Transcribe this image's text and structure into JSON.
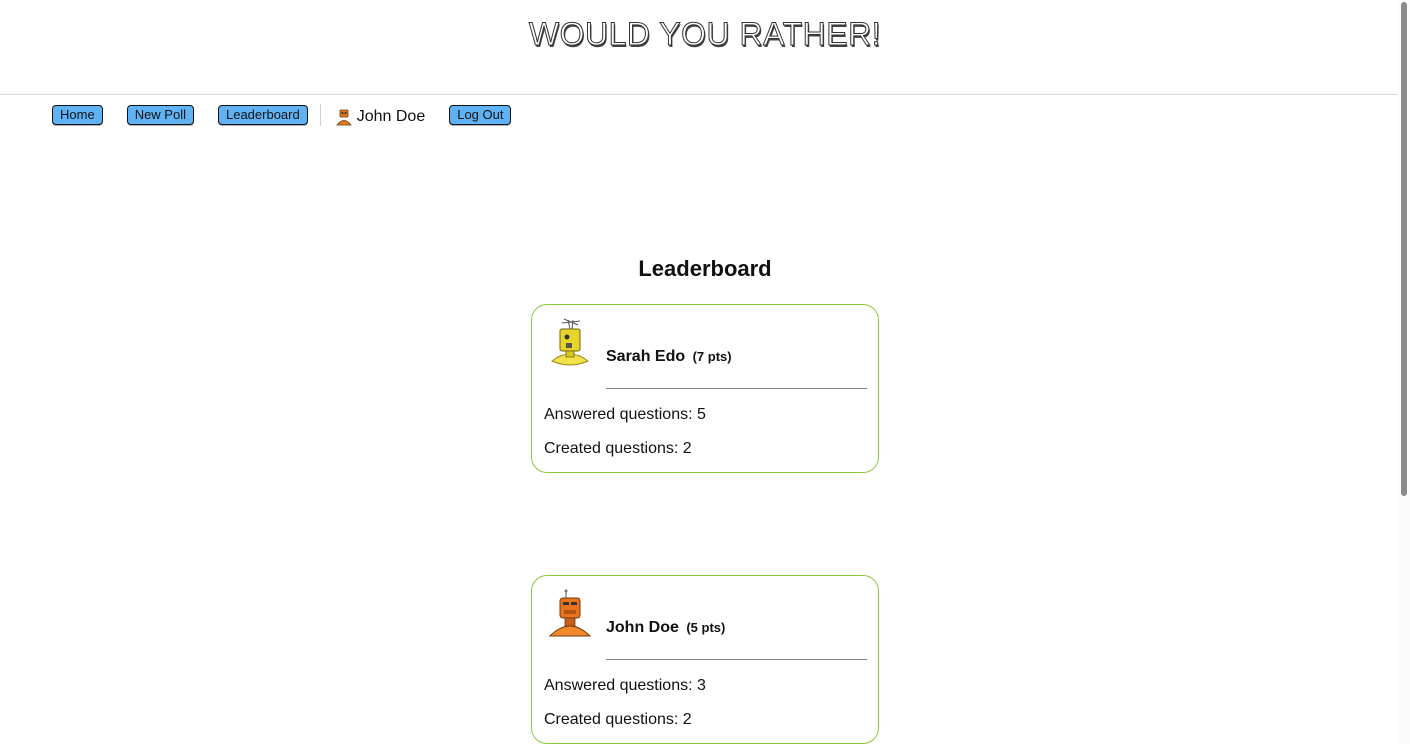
{
  "app": {
    "title": "WOULD YOU RATHER!"
  },
  "nav": {
    "home_label": "Home",
    "new_poll_label": "New Poll",
    "leaderboard_label": "Leaderboard",
    "user_name": "John Doe",
    "user_avatar_icon": "robot-avatar-icon",
    "logout_label": "Log Out"
  },
  "colors": {
    "nav_button_bg": "#5fb3f5",
    "card_border": "#8cc63f"
  },
  "leaderboard": {
    "heading": "Leaderboard",
    "entries": [
      {
        "name": "Sarah Edo",
        "points": "(7 pts)",
        "answered": "Answered questions: 5",
        "created": "Created questions: 2",
        "avatar_icon": "yellow-robot-avatar-icon"
      },
      {
        "name": "John Doe",
        "points": "(5 pts)",
        "answered": "Answered questions: 3",
        "created": "Created questions: 2",
        "avatar_icon": "orange-robot-avatar-icon"
      }
    ]
  }
}
